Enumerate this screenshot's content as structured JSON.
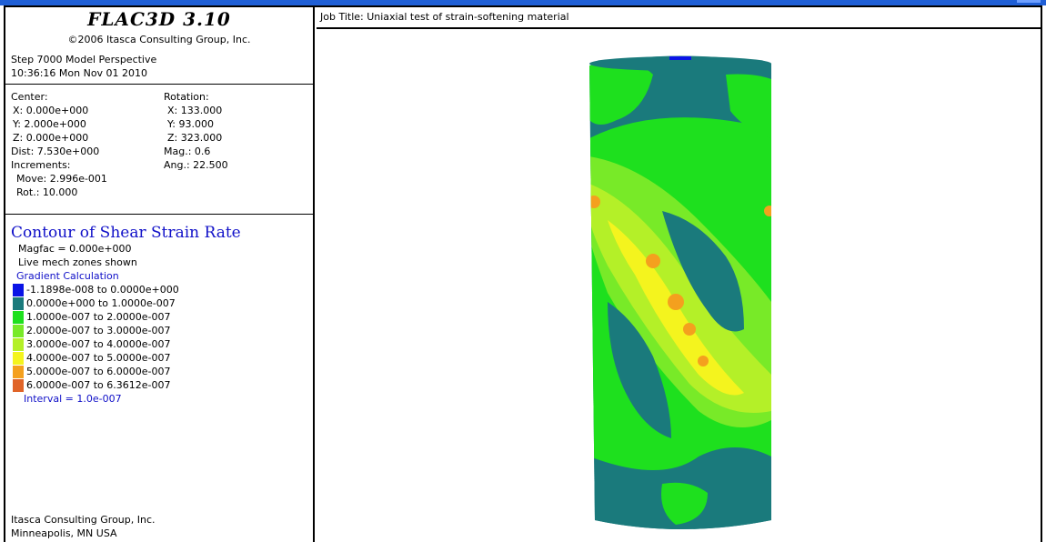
{
  "header": {
    "app_title": "FLAC3D 3.10",
    "copyright": "©2006 Itasca Consulting Group, Inc.",
    "step_line": "Step 7000  Model Perspective",
    "datetime": "10:36:16 Mon Nov 01 2010"
  },
  "view": {
    "center_label": "Center:",
    "center_x": "X: 0.000e+000",
    "center_y": "Y: 2.000e+000",
    "center_z": "Z: 0.000e+000",
    "dist": "Dist: 7.530e+000",
    "increments": "Increments:",
    "move": "Move: 2.996e-001",
    "rot": "Rot.:  10.000",
    "rotation_label": "Rotation:",
    "rot_x": "X: 133.000",
    "rot_y": "Y:  93.000",
    "rot_z": "Z: 323.000",
    "mag": "Mag.:      0.6",
    "ang": "Ang.:  22.500"
  },
  "contour": {
    "title": "Contour of Shear Strain Rate",
    "magfac": "Magfac =  0.000e+000",
    "zones": "Live mech zones shown",
    "gradient": "Gradient Calculation",
    "interval": "Interval =  1.0e-007",
    "legend": [
      {
        "label": "-1.1898e-008 to  0.0000e+000",
        "color": "#0a14e6"
      },
      {
        "label": " 0.0000e+000 to  1.0000e-007",
        "color": "#1a7a7c"
      },
      {
        "label": " 1.0000e-007 to  2.0000e-007",
        "color": "#1ee01e"
      },
      {
        "label": " 2.0000e-007 to  3.0000e-007",
        "color": "#78ea28"
      },
      {
        "label": " 3.0000e-007 to  4.0000e-007",
        "color": "#b4f028"
      },
      {
        "label": " 4.0000e-007 to  5.0000e-007",
        "color": "#f4f41e"
      },
      {
        "label": " 5.0000e-007 to  6.0000e-007",
        "color": "#f4a01e"
      },
      {
        "label": " 6.0000e-007 to  6.3612e-007",
        "color": "#e06428"
      }
    ]
  },
  "footer": {
    "line1": "Itasca Consulting Group, Inc.",
    "line2": "Minneapolis, MN  USA"
  },
  "job": {
    "title": "Job Title:   Uniaxial test of strain-softening material"
  }
}
